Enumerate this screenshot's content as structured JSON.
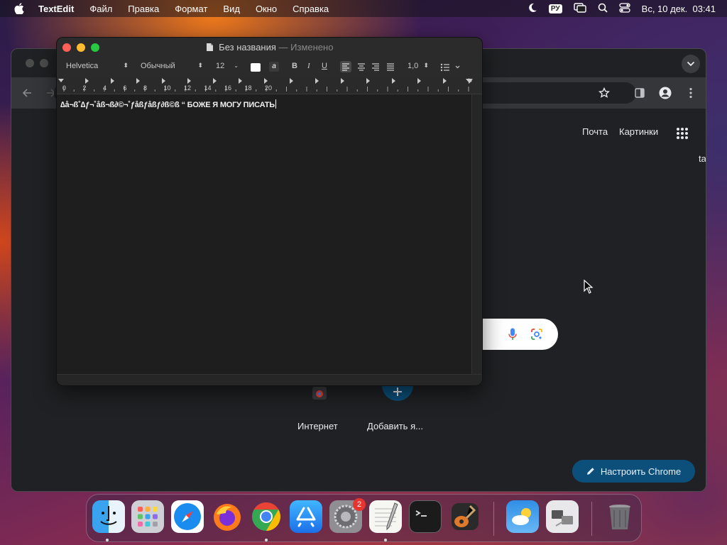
{
  "menubar": {
    "app_name": "TextEdit",
    "items": [
      "Файл",
      "Правка",
      "Формат",
      "Вид",
      "Окно",
      "Справка"
    ],
    "input_source": "РУ",
    "datetime": "Вс, 10 дек.  03:41",
    "icons": [
      "apple-icon",
      "moon-icon",
      "screen-mirroring-icon",
      "search-icon",
      "control-center-icon"
    ]
  },
  "textedit": {
    "title": "Без названия",
    "separator": "—",
    "modified": "Изменено",
    "font": "Helvetica",
    "style": "Обычный",
    "size": "12",
    "bold": "B",
    "italic": "I",
    "underline": "U",
    "spacing": "1,0",
    "ruler_labels": [
      "0",
      "2",
      "4",
      "6",
      "8",
      "10",
      "12",
      "14",
      "16",
      "18",
      "20"
    ],
    "content": "∆å¬ß˚∆ƒ¬˚åß¬ß∂©¬˚ƒåßƒåßƒ∂ß©ß “ БОЖЕ Я МОГУ ПИСАТЬ"
  },
  "chrome": {
    "link_mail": "Почта",
    "link_images": "Картинки",
    "partial_text": "ta",
    "shortcut_internet": "Интернет",
    "shortcut_add": "Добавить я...",
    "customize_label": "Настроить Chrome",
    "colors": {
      "page_bg": "#202124",
      "customize_bg": "#0b4f7a"
    }
  },
  "dock": {
    "apps": [
      "finder",
      "launchpad",
      "safari",
      "firefox",
      "chrome",
      "app-store",
      "system-settings",
      "textedit",
      "terminal",
      "garageband",
      "weather",
      "migration-assistant",
      "trash"
    ],
    "settings_badge": "2"
  }
}
